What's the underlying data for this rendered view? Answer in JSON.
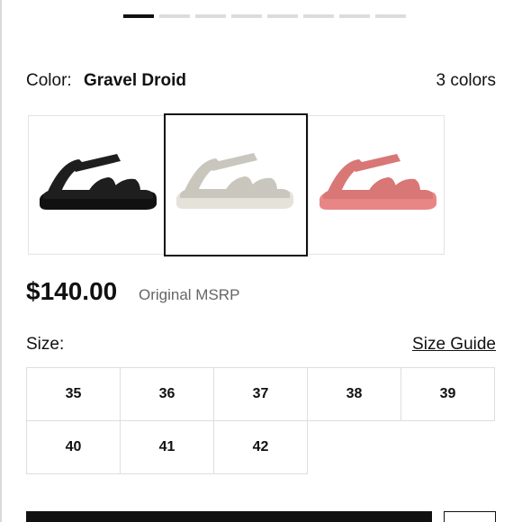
{
  "carousel": {
    "total": 8,
    "active": 0
  },
  "color": {
    "label": "Color:",
    "selected_name": "Gravel Droid",
    "count_text": "3 colors",
    "swatches": [
      {
        "name": "black",
        "color": "#1e1e1e",
        "sole": "#111111",
        "selected": false
      },
      {
        "name": "gravel",
        "color": "#c9c7bd",
        "sole": "#e4e2d9",
        "selected": true
      },
      {
        "name": "pink",
        "color": "#d97676",
        "sole": "#e88686",
        "selected": false
      }
    ]
  },
  "price": {
    "value": "$140.00",
    "note": "Original MSRP"
  },
  "size": {
    "label": "Size:",
    "guide_link": "Size Guide",
    "options": [
      "35",
      "36",
      "37",
      "38",
      "39",
      "40",
      "41",
      "42"
    ]
  }
}
